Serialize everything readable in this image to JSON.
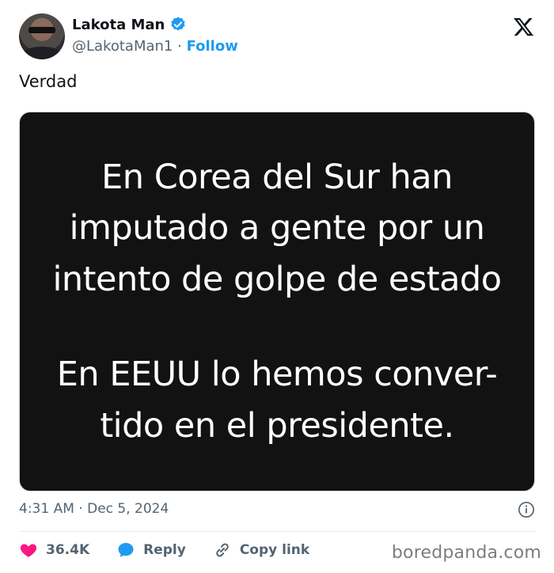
{
  "author": {
    "name": "Lakota Man",
    "handle": "@LakotaMan1",
    "separator": "·",
    "follow_label": "Follow"
  },
  "tweet": {
    "text": "Verdad",
    "image_text": {
      "paragraph_1": "En Corea del Sur han\nimputado a gente por un\nintento de golpe de estado",
      "paragraph_2": "En EEUU lo hemos conver-\ntido en el presidente."
    },
    "time": "4:31 AM",
    "date_separator": "·",
    "date": "Dec 5, 2024"
  },
  "actions": {
    "likes": "36.4K",
    "reply_label": "Reply",
    "copy_link_label": "Copy link"
  },
  "watermark": "boredpanda.com",
  "colors": {
    "accent": "#1d9bf0",
    "like": "#f91880",
    "media_bg": "#121212"
  }
}
